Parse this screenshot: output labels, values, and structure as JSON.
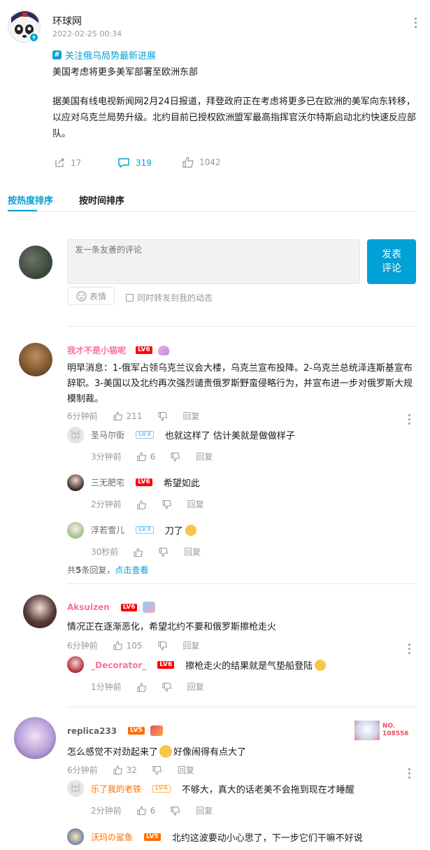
{
  "post": {
    "author": "环球网",
    "timestamp": "2022-02-25 00:34",
    "topic": "关注俄乌局势最新进展",
    "headline": "美国考虑将更多美军部署至欧洲东部",
    "body": "据美国有线电视新闻网2月24日报道，拜登政府正在考虑将更多已在欧洲的美军向东转移，以应对乌克兰局势升级。北约目前已授权欧洲盟军最高指挥官沃尔特斯启动北约快速反应部队。",
    "share_count": "17",
    "comment_count": "319",
    "like_count": "1042"
  },
  "tabs": {
    "hot": "按热度排序",
    "time": "按时间排序"
  },
  "composer": {
    "placeholder": "发一条友善的评论",
    "submit_line1": "发表",
    "submit_line2": "评论",
    "emoji_label": "表情",
    "forward_label": "同时转发到我的动态"
  },
  "comments": [
    {
      "user": "我才不是小猫呢",
      "level": "LV6",
      "text": "明早消息：1-俄军占领乌克兰议会大楼，乌克兰宣布投降。2-乌克兰总统泽连斯基宣布辞职。3-美国以及北约再次强烈谴责俄罗斯野蛮侵略行为，并宣布进一步对俄罗斯大规模制裁。",
      "time": "6分钟前",
      "likes": "211",
      "reply_label": "回复",
      "replies": [
        {
          "user": "圣马尔街",
          "level": "LV3",
          "text": "也就这样了 估计美就是做做样子",
          "time": "3分钟前",
          "likes": "6",
          "reply_label": "回复"
        },
        {
          "user": "三无肥宅",
          "level": "LV6",
          "text": "希望如此",
          "time": "2分钟前",
          "likes": "",
          "reply_label": "回复"
        },
        {
          "user": "浮若雪儿",
          "level": "LV3",
          "text": "刀了",
          "time": "30秒前",
          "likes": "",
          "reply_label": "回复"
        }
      ],
      "more_prefix": "共",
      "more_count": "5",
      "more_suffix": "条回复，",
      "more_link": "点击查看"
    },
    {
      "user": "Aksuizen",
      "level": "LV6",
      "text": "情况正在逐渐恶化，希望北约不要和俄罗斯擦枪走火",
      "time": "6分钟前",
      "likes": "105",
      "reply_label": "回复",
      "replies": [
        {
          "user": "_Decorator_",
          "level": "LV6",
          "text": "擦枪走火的结果就是气垫船登陆",
          "time": "1分钟前",
          "likes": "",
          "reply_label": "回复"
        }
      ]
    },
    {
      "user": "replica233",
      "level": "LV5",
      "text_a": "怎么感觉不对劲起来了",
      "text_b": "好像闹得有点大了",
      "time": "6分钟前",
      "likes": "32",
      "reply_label": "回复",
      "badge_no": "NO.",
      "badge_num": "108556",
      "replies": [
        {
          "user": "乐了我的老铁",
          "level": "LV4",
          "text": "不够大，真大的话老美不会拖到现在才睡醒",
          "time": "2分钟前",
          "likes": "6",
          "reply_label": "回复"
        },
        {
          "user": "沃玛の鲨鱼",
          "level": "LV5",
          "text": "北约这波要动小心思了，下一步它们干嘛不好说",
          "time": "",
          "likes": "",
          "reply_label": ""
        }
      ]
    }
  ],
  "colors": {
    "accent": "#00a1d6",
    "pink": "#fb7299",
    "orange": "#ff6c00",
    "gray": "#9499a0"
  },
  "icons": [
    "verified-icon",
    "topic-hash-icon",
    "share-icon",
    "comment-icon",
    "like-icon",
    "dislike-icon",
    "emoji-icon",
    "more-icon"
  ]
}
